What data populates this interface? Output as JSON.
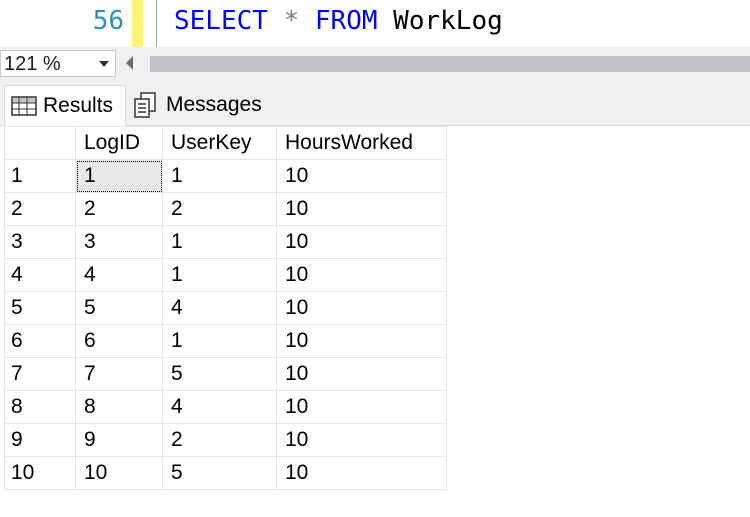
{
  "editor": {
    "line_number": "56",
    "code": {
      "kw1": "SELECT",
      "op": "*",
      "kw2": "FROM",
      "table": "WorkLog"
    }
  },
  "zoom": {
    "value": "121 %"
  },
  "tabs": [
    {
      "label": "Results",
      "icon": "grid-icon"
    },
    {
      "label": "Messages",
      "icon": "messages-icon"
    }
  ],
  "results": {
    "columns": [
      "LogID",
      "UserKey",
      "HoursWorked"
    ],
    "rows": [
      [
        "1",
        "1",
        "1",
        "10"
      ],
      [
        "2",
        "2",
        "2",
        "10"
      ],
      [
        "3",
        "3",
        "1",
        "10"
      ],
      [
        "4",
        "4",
        "1",
        "10"
      ],
      [
        "5",
        "5",
        "4",
        "10"
      ],
      [
        "6",
        "6",
        "1",
        "10"
      ],
      [
        "7",
        "7",
        "5",
        "10"
      ],
      [
        "8",
        "8",
        "4",
        "10"
      ],
      [
        "9",
        "9",
        "2",
        "10"
      ],
      [
        "10",
        "10",
        "5",
        "10"
      ]
    ]
  }
}
